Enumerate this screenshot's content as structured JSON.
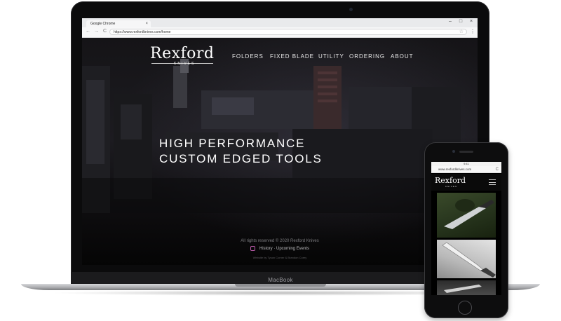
{
  "laptop": {
    "brand_label": "MacBook",
    "browser": {
      "window_title": "Google Chrome",
      "tab_title": "",
      "close_glyph": "×",
      "min_glyph": "–",
      "max_glyph": "□",
      "winclose_glyph": "×",
      "back_glyph": "←",
      "fwd_glyph": "→",
      "reload_glyph": "C",
      "star_glyph": "☆",
      "menu_glyph": "⋮",
      "url": "https://www.rexfordknives.com/home"
    },
    "site": {
      "logo": {
        "name": "Rexford",
        "sub": "KNIVES"
      },
      "nav": [
        "FOLDERS",
        "FIXED BLADE",
        "UTILITY",
        "ORDERING",
        "ABOUT"
      ],
      "hero": {
        "line1": "HIGH PERFORMANCE",
        "line2": "CUSTOM EDGED TOOLS"
      },
      "footer": {
        "copyright": "All rights reserved © 2020 Rexford Knives",
        "link1": "History",
        "separator": "·",
        "link2": "Upcoming Events",
        "credit": "Website by Tyson Corner & Brandon Corey"
      }
    }
  },
  "phone": {
    "status_time": "9:41",
    "url": "www.rexfordknives.com",
    "reload_glyph": "C",
    "logo": {
      "name": "Rexford",
      "sub": "KNIVES"
    },
    "menu_icon": "hamburger-icon"
  },
  "colors": {
    "site_background": "#151417",
    "instagram_accent": "#b85aa8",
    "laptop_body": "#0b0b0c",
    "laptop_base": "#a7a8ab"
  }
}
